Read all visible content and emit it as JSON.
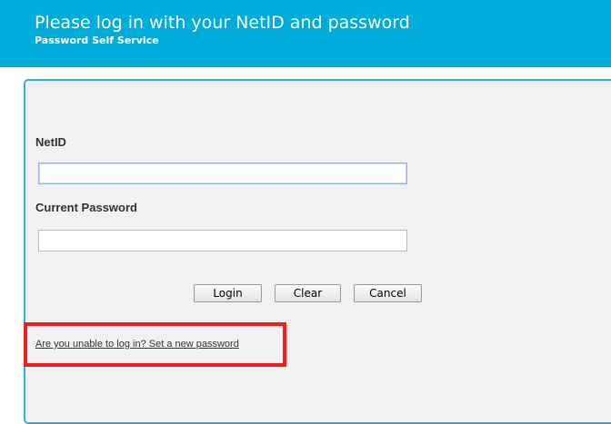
{
  "header": {
    "title": "Please log in with your NetID and password",
    "subtitle": "Password Self Service"
  },
  "form": {
    "netid_label": "NetID",
    "netid_value": "",
    "password_label": "Current Password",
    "password_value": ""
  },
  "buttons": {
    "login": "Login",
    "clear": "Clear",
    "cancel": "Cancel"
  },
  "help": {
    "link_text": "Are you unable to log in? Set a new password"
  },
  "colors": {
    "header_bg": "#00acd9",
    "panel_border": "#28b2dc",
    "highlight": "#ef1e1e"
  }
}
